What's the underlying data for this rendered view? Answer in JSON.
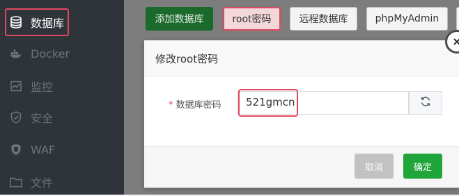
{
  "sidebar": {
    "items": [
      {
        "label": "数据库",
        "icon": "database-icon",
        "active": true
      },
      {
        "label": "Docker",
        "icon": "docker-icon"
      },
      {
        "label": "监控",
        "icon": "monitor-icon"
      },
      {
        "label": "安全",
        "icon": "shield-icon"
      },
      {
        "label": "WAF",
        "icon": "waf-shield-icon"
      },
      {
        "label": "文件",
        "icon": "folder-icon"
      }
    ]
  },
  "toolbar": {
    "add_db": "添加数据库",
    "root_pwd": "root密码",
    "remote_db": "远程数据库",
    "phpmyadmin": "phpMyAdmin"
  },
  "dialog": {
    "title": "修改root密码",
    "field_required_mark": "*",
    "field_label": "数据库密码",
    "password_value": "521gmcn",
    "cancel": "取消",
    "confirm": "确定"
  },
  "colors": {
    "highlight": "#e0485e",
    "primary_green": "#20a53a",
    "sidebar_bg": "#2f343a"
  }
}
